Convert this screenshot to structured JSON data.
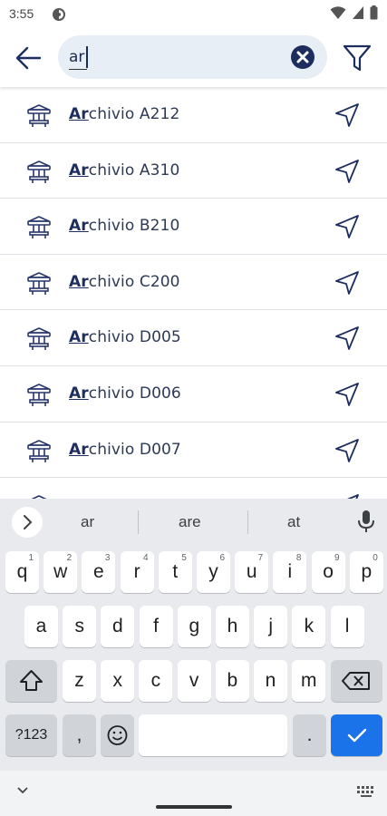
{
  "status_bar": {
    "time": "3:55"
  },
  "search": {
    "query": "ar",
    "underline_text": "ar"
  },
  "results": [
    {
      "prefix": "Ar",
      "rest": "chivio A212"
    },
    {
      "prefix": "Ar",
      "rest": "chivio A310"
    },
    {
      "prefix": "Ar",
      "rest": "chivio B210"
    },
    {
      "prefix": "Ar",
      "rest": "chivio C200"
    },
    {
      "prefix": "Ar",
      "rest": "chivio D005"
    },
    {
      "prefix": "Ar",
      "rest": "chivio D006"
    },
    {
      "prefix": "Ar",
      "rest": "chivio D007"
    }
  ],
  "keyboard": {
    "suggestions": [
      "ar",
      "are",
      "at"
    ],
    "row1": [
      {
        "k": "q",
        "n": "1"
      },
      {
        "k": "w",
        "n": "2"
      },
      {
        "k": "e",
        "n": "3"
      },
      {
        "k": "r",
        "n": "4"
      },
      {
        "k": "t",
        "n": "5"
      },
      {
        "k": "y",
        "n": "6"
      },
      {
        "k": "u",
        "n": "7"
      },
      {
        "k": "i",
        "n": "8"
      },
      {
        "k": "o",
        "n": "9"
      },
      {
        "k": "p",
        "n": "0"
      }
    ],
    "row2": [
      "a",
      "s",
      "d",
      "f",
      "g",
      "h",
      "j",
      "k",
      "l"
    ],
    "row3": [
      "z",
      "x",
      "c",
      "v",
      "b",
      "n",
      "m"
    ],
    "symbols_label": "?123",
    "comma_label": ",",
    "period_label": "."
  },
  "colors": {
    "accent": "#1a73e8",
    "navy": "#1c2d5e",
    "search_bg": "#e8eef5"
  },
  "icons": [
    "back-arrow-icon",
    "clear-icon",
    "filter-icon",
    "building-icon",
    "navigate-icon",
    "mic-icon",
    "shift-icon",
    "backspace-icon",
    "emoji-icon",
    "check-icon"
  ]
}
